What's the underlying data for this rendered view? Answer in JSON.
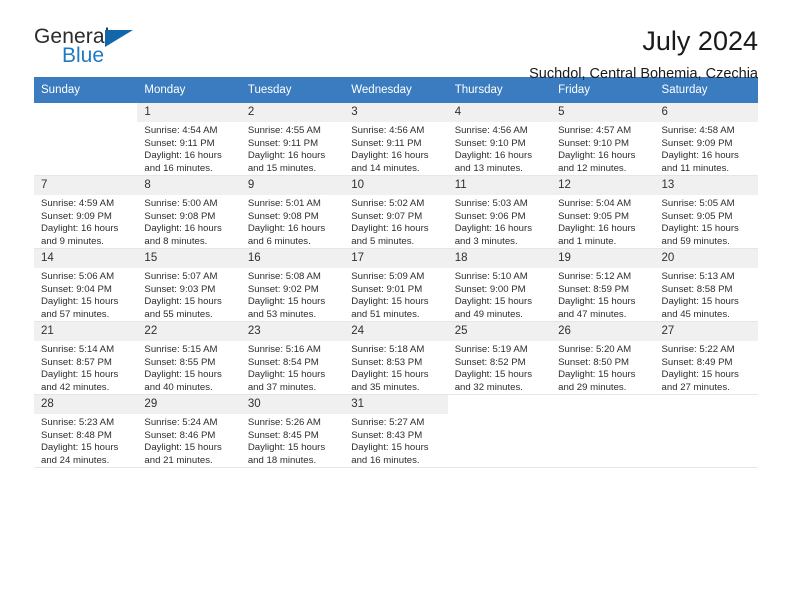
{
  "brand": {
    "name_part1": "General",
    "name_part2": "Blue",
    "accent_color": "#1267ab",
    "logo_icon": "triangle-flag-icon"
  },
  "header": {
    "title": "July 2024",
    "subtitle": "Suchdol, Central Bohemia, Czechia"
  },
  "calendar": {
    "header_bg": "#3a7cbf",
    "daynum_bg": "#f0f0f0",
    "weekday_headers": [
      "Sunday",
      "Monday",
      "Tuesday",
      "Wednesday",
      "Thursday",
      "Friday",
      "Saturday"
    ],
    "weeks": [
      [
        {
          "day": "",
          "blank": true
        },
        {
          "day": "1",
          "sunrise": "Sunrise: 4:54 AM",
          "sunset": "Sunset: 9:11 PM",
          "daylight": "Daylight: 16 hours and 16 minutes."
        },
        {
          "day": "2",
          "sunrise": "Sunrise: 4:55 AM",
          "sunset": "Sunset: 9:11 PM",
          "daylight": "Daylight: 16 hours and 15 minutes."
        },
        {
          "day": "3",
          "sunrise": "Sunrise: 4:56 AM",
          "sunset": "Sunset: 9:11 PM",
          "daylight": "Daylight: 16 hours and 14 minutes."
        },
        {
          "day": "4",
          "sunrise": "Sunrise: 4:56 AM",
          "sunset": "Sunset: 9:10 PM",
          "daylight": "Daylight: 16 hours and 13 minutes."
        },
        {
          "day": "5",
          "sunrise": "Sunrise: 4:57 AM",
          "sunset": "Sunset: 9:10 PM",
          "daylight": "Daylight: 16 hours and 12 minutes."
        },
        {
          "day": "6",
          "sunrise": "Sunrise: 4:58 AM",
          "sunset": "Sunset: 9:09 PM",
          "daylight": "Daylight: 16 hours and 11 minutes."
        }
      ],
      [
        {
          "day": "7",
          "sunrise": "Sunrise: 4:59 AM",
          "sunset": "Sunset: 9:09 PM",
          "daylight": "Daylight: 16 hours and 9 minutes."
        },
        {
          "day": "8",
          "sunrise": "Sunrise: 5:00 AM",
          "sunset": "Sunset: 9:08 PM",
          "daylight": "Daylight: 16 hours and 8 minutes."
        },
        {
          "day": "9",
          "sunrise": "Sunrise: 5:01 AM",
          "sunset": "Sunset: 9:08 PM",
          "daylight": "Daylight: 16 hours and 6 minutes."
        },
        {
          "day": "10",
          "sunrise": "Sunrise: 5:02 AM",
          "sunset": "Sunset: 9:07 PM",
          "daylight": "Daylight: 16 hours and 5 minutes."
        },
        {
          "day": "11",
          "sunrise": "Sunrise: 5:03 AM",
          "sunset": "Sunset: 9:06 PM",
          "daylight": "Daylight: 16 hours and 3 minutes."
        },
        {
          "day": "12",
          "sunrise": "Sunrise: 5:04 AM",
          "sunset": "Sunset: 9:05 PM",
          "daylight": "Daylight: 16 hours and 1 minute."
        },
        {
          "day": "13",
          "sunrise": "Sunrise: 5:05 AM",
          "sunset": "Sunset: 9:05 PM",
          "daylight": "Daylight: 15 hours and 59 minutes."
        }
      ],
      [
        {
          "day": "14",
          "sunrise": "Sunrise: 5:06 AM",
          "sunset": "Sunset: 9:04 PM",
          "daylight": "Daylight: 15 hours and 57 minutes."
        },
        {
          "day": "15",
          "sunrise": "Sunrise: 5:07 AM",
          "sunset": "Sunset: 9:03 PM",
          "daylight": "Daylight: 15 hours and 55 minutes."
        },
        {
          "day": "16",
          "sunrise": "Sunrise: 5:08 AM",
          "sunset": "Sunset: 9:02 PM",
          "daylight": "Daylight: 15 hours and 53 minutes."
        },
        {
          "day": "17",
          "sunrise": "Sunrise: 5:09 AM",
          "sunset": "Sunset: 9:01 PM",
          "daylight": "Daylight: 15 hours and 51 minutes."
        },
        {
          "day": "18",
          "sunrise": "Sunrise: 5:10 AM",
          "sunset": "Sunset: 9:00 PM",
          "daylight": "Daylight: 15 hours and 49 minutes."
        },
        {
          "day": "19",
          "sunrise": "Sunrise: 5:12 AM",
          "sunset": "Sunset: 8:59 PM",
          "daylight": "Daylight: 15 hours and 47 minutes."
        },
        {
          "day": "20",
          "sunrise": "Sunrise: 5:13 AM",
          "sunset": "Sunset: 8:58 PM",
          "daylight": "Daylight: 15 hours and 45 minutes."
        }
      ],
      [
        {
          "day": "21",
          "sunrise": "Sunrise: 5:14 AM",
          "sunset": "Sunset: 8:57 PM",
          "daylight": "Daylight: 15 hours and 42 minutes."
        },
        {
          "day": "22",
          "sunrise": "Sunrise: 5:15 AM",
          "sunset": "Sunset: 8:55 PM",
          "daylight": "Daylight: 15 hours and 40 minutes."
        },
        {
          "day": "23",
          "sunrise": "Sunrise: 5:16 AM",
          "sunset": "Sunset: 8:54 PM",
          "daylight": "Daylight: 15 hours and 37 minutes."
        },
        {
          "day": "24",
          "sunrise": "Sunrise: 5:18 AM",
          "sunset": "Sunset: 8:53 PM",
          "daylight": "Daylight: 15 hours and 35 minutes."
        },
        {
          "day": "25",
          "sunrise": "Sunrise: 5:19 AM",
          "sunset": "Sunset: 8:52 PM",
          "daylight": "Daylight: 15 hours and 32 minutes."
        },
        {
          "day": "26",
          "sunrise": "Sunrise: 5:20 AM",
          "sunset": "Sunset: 8:50 PM",
          "daylight": "Daylight: 15 hours and 29 minutes."
        },
        {
          "day": "27",
          "sunrise": "Sunrise: 5:22 AM",
          "sunset": "Sunset: 8:49 PM",
          "daylight": "Daylight: 15 hours and 27 minutes."
        }
      ],
      [
        {
          "day": "28",
          "sunrise": "Sunrise: 5:23 AM",
          "sunset": "Sunset: 8:48 PM",
          "daylight": "Daylight: 15 hours and 24 minutes."
        },
        {
          "day": "29",
          "sunrise": "Sunrise: 5:24 AM",
          "sunset": "Sunset: 8:46 PM",
          "daylight": "Daylight: 15 hours and 21 minutes."
        },
        {
          "day": "30",
          "sunrise": "Sunrise: 5:26 AM",
          "sunset": "Sunset: 8:45 PM",
          "daylight": "Daylight: 15 hours and 18 minutes."
        },
        {
          "day": "31",
          "sunrise": "Sunrise: 5:27 AM",
          "sunset": "Sunset: 8:43 PM",
          "daylight": "Daylight: 15 hours and 16 minutes."
        },
        {
          "day": "",
          "blank": true
        },
        {
          "day": "",
          "blank": true
        },
        {
          "day": "",
          "blank": true
        }
      ]
    ]
  }
}
